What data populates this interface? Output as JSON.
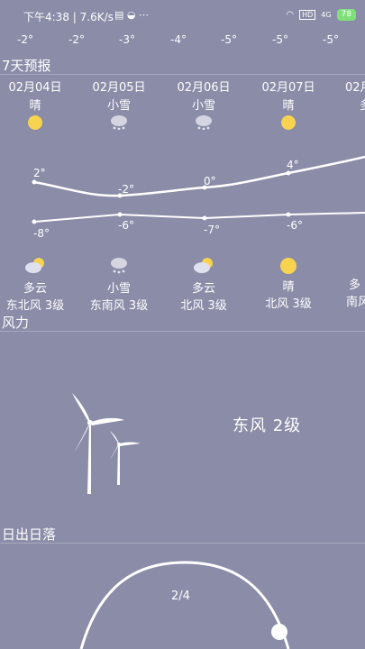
{
  "status": {
    "text": "下午4:38 | 7.6K/s",
    "battery": "78",
    "hd": "HD",
    "signal": "4G"
  },
  "hourly": [
    "-2°",
    "-2°",
    "-3°",
    "-4°",
    "-5°",
    "-5°",
    "-5°"
  ],
  "forecast": {
    "title": "7天预报",
    "days": [
      {
        "date": "02月04日",
        "weather_top": "晴",
        "icon_top": "sun-icon",
        "high": "2°",
        "low": "-8°",
        "icon_bottom": "partly-cloudy-icon",
        "weather_bottom": "多云",
        "wind": "东北风 3级"
      },
      {
        "date": "02月05日",
        "weather_top": "小雪",
        "icon_top": "snow-icon",
        "high": "-2°",
        "low": "-6°",
        "icon_bottom": "snow-icon",
        "weather_bottom": "小雪",
        "wind": "东南风 3级"
      },
      {
        "date": "02月06日",
        "weather_top": "小雪",
        "icon_top": "snow-icon",
        "high": "0°",
        "low": "-7°",
        "icon_bottom": "partly-cloudy-icon",
        "weather_bottom": "多云",
        "wind": "北风 3级"
      },
      {
        "date": "02月07日",
        "weather_top": "晴",
        "icon_top": "sun-icon",
        "high": "4°",
        "low": "-6°",
        "icon_bottom": "sun-icon",
        "weather_bottom": "晴",
        "wind": "北风 3级"
      },
      {
        "date": "02月",
        "weather_top": "多",
        "icon_top": "",
        "high": "",
        "low": "",
        "icon_bottom": "",
        "weather_bottom": "多",
        "wind": "南风"
      }
    ]
  },
  "wind": {
    "title": "风力",
    "desc": "东风 2级"
  },
  "sun": {
    "title": "日出日落",
    "counter": "2/4"
  },
  "colors": {
    "background": "#8a8ca8",
    "sun": "#f7d34f",
    "battery": "#7fe07a"
  }
}
